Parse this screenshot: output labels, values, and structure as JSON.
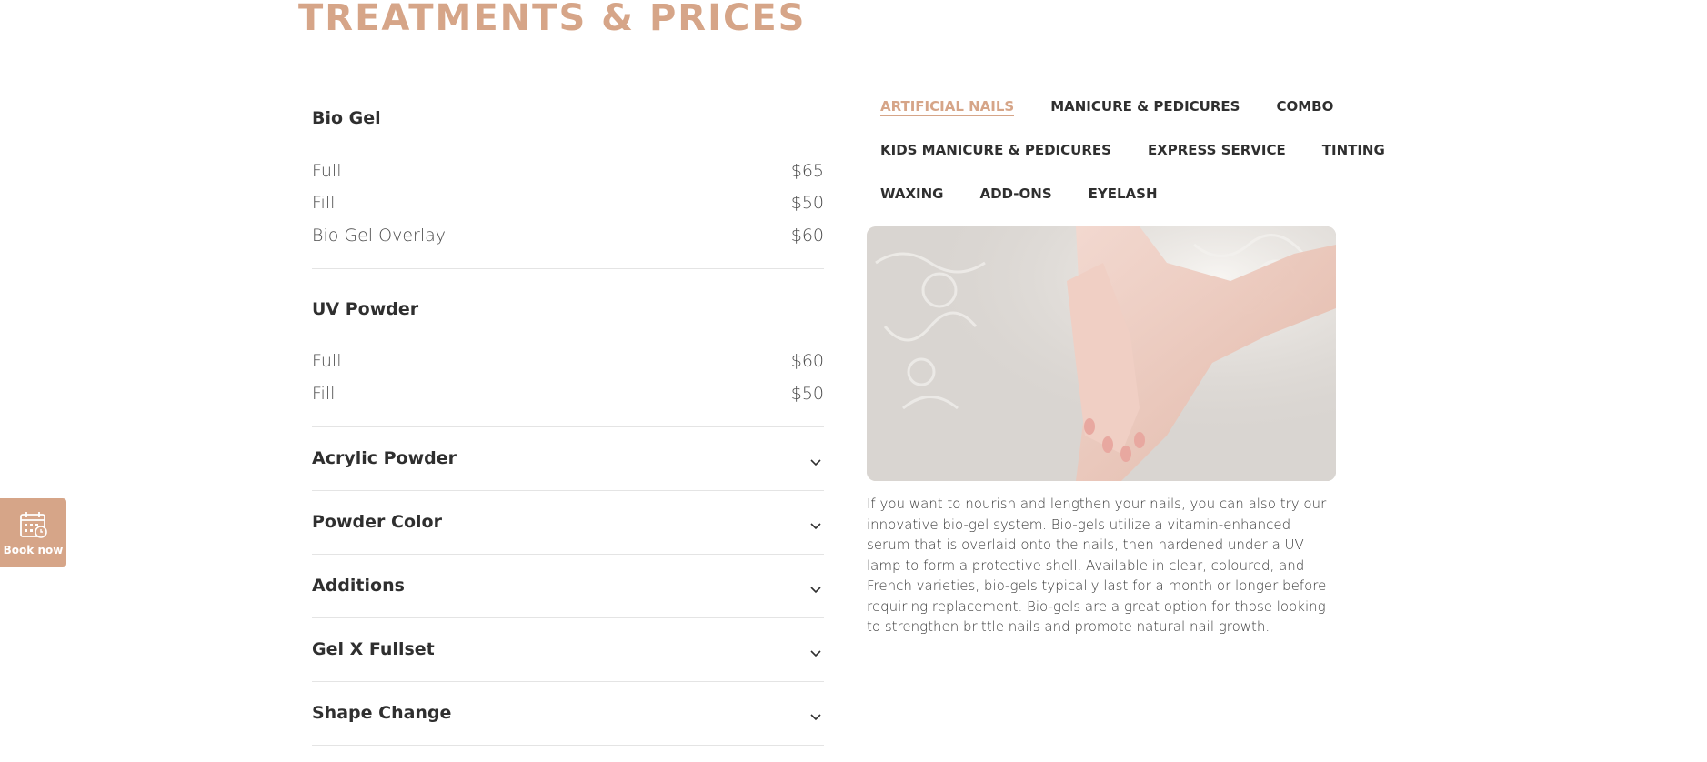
{
  "page_title": "TREATMENTS & PRICES",
  "open_sections": [
    {
      "title": "Bio Gel",
      "items": [
        {
          "name": "Full",
          "price": "$65"
        },
        {
          "name": "Fill",
          "price": "$50"
        },
        {
          "name": "Bio Gel Overlay",
          "price": "$60"
        }
      ]
    },
    {
      "title": "UV Powder",
      "items": [
        {
          "name": "Full",
          "price": "$60"
        },
        {
          "name": "Fill",
          "price": "$50"
        }
      ]
    }
  ],
  "collapsed_sections": [
    "Acrylic Powder",
    "Powder Color",
    "Additions",
    "Gel X Fullset",
    "Shape Change"
  ],
  "tabs": [
    [
      "ARTIFICIAL NAILS",
      "MANICURE & PEDICURES",
      "COMBO"
    ],
    [
      "KIDS MANICURE & PEDICURES",
      "EXPRESS SERVICE",
      "TINTING"
    ],
    [
      "WAXING",
      "ADD-ONS",
      "EYELASH"
    ]
  ],
  "active_tab": "ARTIFICIAL NAILS",
  "description": "If you want to nourish and lengthen your nails, you can also try our innovative bio-gel system. Bio-gels utilize a vitamin-enhanced serum that is overlaid onto the nails, then hardened under a UV lamp to form a protective shell. Available in clear, coloured, and French varieties, bio-gels typically last for a month or longer before requiring replacement. Bio-gels are a great option for those looking to strengthen brittle nails and promote natural nail growth.",
  "book_button": {
    "label": "Book now",
    "icon": "calendar-icon"
  },
  "colors": {
    "accent": "#d6a588",
    "text": "#2f2f2f",
    "divider": "#e4e4e4"
  }
}
